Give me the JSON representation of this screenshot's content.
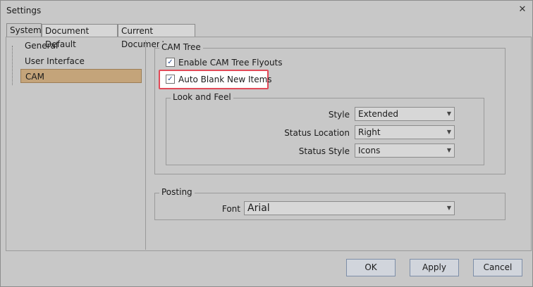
{
  "window": {
    "title": "Settings",
    "close_glyph": "✕"
  },
  "tabs": [
    "System",
    "Document Default",
    "Current Document"
  ],
  "tree": {
    "items": [
      "General",
      "User Interface",
      "CAM"
    ],
    "selected": "CAM"
  },
  "cam_tree": {
    "legend": "CAM Tree",
    "enable_flyouts": {
      "label": "Enable CAM Tree Flyouts",
      "checked": true
    },
    "auto_blank": {
      "label": "Auto Blank New Items",
      "checked": true
    },
    "look_and_feel": {
      "legend": "Look and Feel",
      "style_label": "Style",
      "style_value": "Extended",
      "status_location_label": "Status Location",
      "status_location_value": "Right",
      "status_style_label": "Status Style",
      "status_style_value": "Icons"
    }
  },
  "posting": {
    "legend": "Posting",
    "font_label": "Font",
    "font_value": "Arial"
  },
  "buttons": {
    "ok": "OK",
    "apply": "Apply",
    "cancel": "Cancel"
  },
  "check_glyph": "✓",
  "dropdown_glyph": "▼",
  "colors": {
    "selection": "#c4a47a",
    "highlight_border": "#e24a58"
  }
}
